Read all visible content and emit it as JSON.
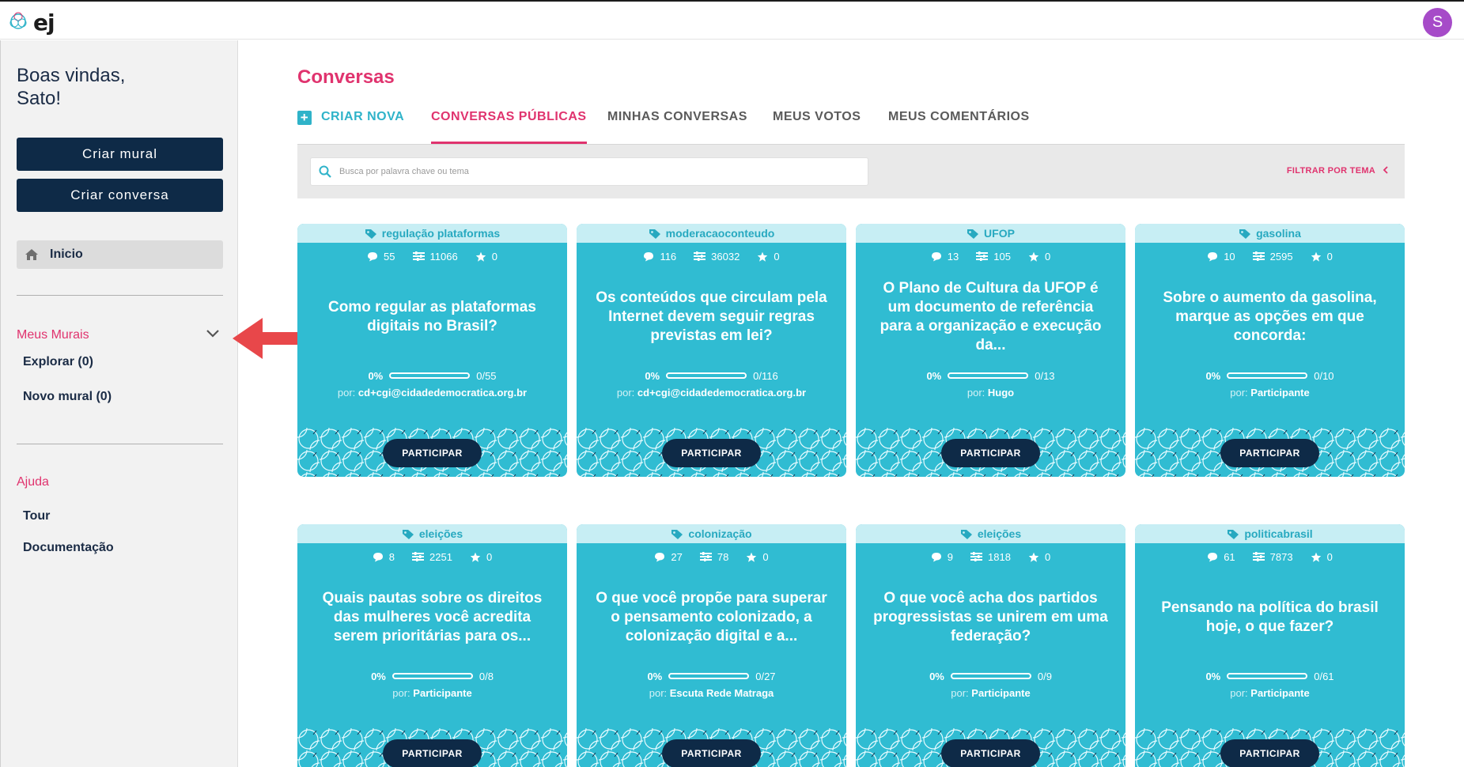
{
  "app": {
    "logo_text": "ej",
    "avatar_letter": "S"
  },
  "sidebar": {
    "welcome": "Boas vindas,\nSato!",
    "welcome_line1": "Boas vindas,",
    "welcome_line2": "Sato!",
    "create_wall_label": "Criar mural",
    "create_conversation_label": "Criar conversa",
    "home_label": "Inicio",
    "my_walls": {
      "title": "Meus Murais",
      "items": [
        {
          "label": "Explorar",
          "count": "(0)"
        },
        {
          "label": "Novo mural",
          "count": "(0)"
        }
      ]
    },
    "help": {
      "title": "Ajuda",
      "items": [
        {
          "label": "Tour"
        },
        {
          "label": "Documentação"
        }
      ]
    }
  },
  "main": {
    "page_title": "Conversas",
    "tabs": [
      {
        "label": "CRIAR NOVA"
      },
      {
        "label": "CONVERSAS PÚBLICAS"
      },
      {
        "label": "MINHAS CONVERSAS"
      },
      {
        "label": "MEUS VOTOS"
      },
      {
        "label": "MEUS COMENTÁRIOS"
      }
    ],
    "search": {
      "placeholder": "Busca por palavra chave ou tema",
      "value": ""
    },
    "filter_label": "FILTRAR POR TEMA",
    "by_label": "por:",
    "participate_label": "PARTICIPAR",
    "cards": [
      {
        "tag": "regulação plataformas",
        "comments": "55",
        "votes": "11066",
        "favorites": "0",
        "title": "Como regular as plataformas digitais no Brasil?",
        "progress_pct": "0%",
        "progress": "0/55",
        "author": "cd+cgi@cidadedemocratica.org.br"
      },
      {
        "tag": "moderacaoconteudo",
        "comments": "116",
        "votes": "36032",
        "favorites": "0",
        "title": "Os conteúdos que circulam pela Internet devem seguir regras previstas em lei?",
        "progress_pct": "0%",
        "progress": "0/116",
        "author": "cd+cgi@cidadedemocratica.org.br"
      },
      {
        "tag": "UFOP",
        "comments": "13",
        "votes": "105",
        "favorites": "0",
        "title": "O Plano de Cultura da UFOP é um documento de referência para a organização e execução da...",
        "progress_pct": "0%",
        "progress": "0/13",
        "author": "Hugo"
      },
      {
        "tag": "gasolina",
        "comments": "10",
        "votes": "2595",
        "favorites": "0",
        "title": "Sobre o aumento da gasolina, marque as opções em que concorda:",
        "progress_pct": "0%",
        "progress": "0/10",
        "author": "Participante"
      },
      {
        "tag": "eleições",
        "comments": "8",
        "votes": "2251",
        "favorites": "0",
        "title": "Quais pautas sobre os direitos das mulheres você acredita serem prioritárias para os...",
        "progress_pct": "0%",
        "progress": "0/8",
        "author": "Participante"
      },
      {
        "tag": "colonização",
        "comments": "27",
        "votes": "78",
        "favorites": "0",
        "title": "O que você propõe para superar o pensamento colonizado, a colonização digital e a...",
        "progress_pct": "0%",
        "progress": "0/27",
        "author": "Escuta Rede Matraga"
      },
      {
        "tag": "eleições",
        "comments": "9",
        "votes": "1818",
        "favorites": "0",
        "title": "O que você acha dos partidos progressistas se unirem em uma federação?",
        "progress_pct": "0%",
        "progress": "0/9",
        "author": "Participante"
      },
      {
        "tag": "politicabrasil",
        "comments": "61",
        "votes": "7873",
        "favorites": "0",
        "title": "Pensando na política do brasil hoje, o que fazer?",
        "progress_pct": "0%",
        "progress": "0/61",
        "author": "Participante"
      }
    ]
  },
  "colors": {
    "accent_pink": "#e0336e",
    "teal": "#30bcd2",
    "navy": "#0e2a47",
    "annotation_red": "#e8474a"
  }
}
